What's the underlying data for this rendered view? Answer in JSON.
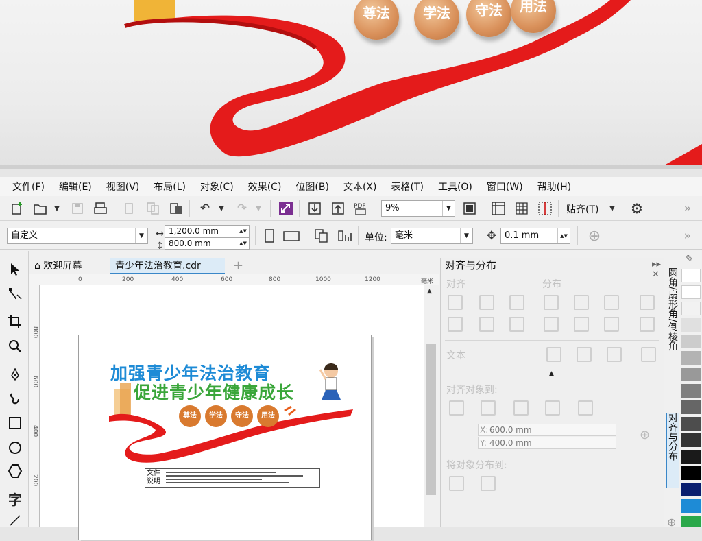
{
  "banner": {
    "coins": [
      "尊法",
      "学法",
      "守法",
      "用法"
    ]
  },
  "menubar": {
    "items": [
      "文件(F)",
      "编辑(E)",
      "视图(V)",
      "布局(L)",
      "对象(C)",
      "效果(C)",
      "位图(B)",
      "文本(X)",
      "表格(T)",
      "工具(O)",
      "窗口(W)",
      "帮助(H)"
    ]
  },
  "toolbar1": {
    "zoom": "9%",
    "snap_label": "贴齐(T)"
  },
  "toolbar2": {
    "preset": "自定义",
    "width": "1,200.0 mm",
    "height": "800.0 mm",
    "unit_label": "单位:",
    "unit_value": "毫米",
    "nudge": "0.1 mm"
  },
  "tabs": {
    "welcome": "欢迎屏幕",
    "document": "青少年法治教育.cdr"
  },
  "ruler": {
    "ticks": [
      "0",
      "200",
      "400",
      "600",
      "800",
      "1000",
      "1200"
    ],
    "unit": "毫米",
    "vticks": [
      "800",
      "600",
      "400",
      "200"
    ]
  },
  "design": {
    "headline1": "加强青少年法治教育",
    "headline2": "促进青少年健康成长",
    "seals": [
      "尊法",
      "学法",
      "守法",
      "用法"
    ],
    "note_label": "文件说明"
  },
  "docker": {
    "title": "对齐与分布",
    "align_label": "对齐",
    "distribute_label": "分布",
    "text_label": "文本",
    "align_to_label": "对齐对象到:",
    "x_prefix": "X:",
    "x_value": "600.0 mm",
    "y_prefix": "Y:",
    "y_value": "400.0 mm",
    "distribute_to_label": "将对象分布到:"
  },
  "sidetabs": {
    "tab1": "圆角/扇形角/倒棱角",
    "tab2": "对齐与分布"
  },
  "colors": {
    "ribbon_red": "#e41b1b",
    "headline_blue": "#1e8bd6",
    "headline_green": "#3aa63a",
    "seal_orange": "#d97a2f"
  }
}
